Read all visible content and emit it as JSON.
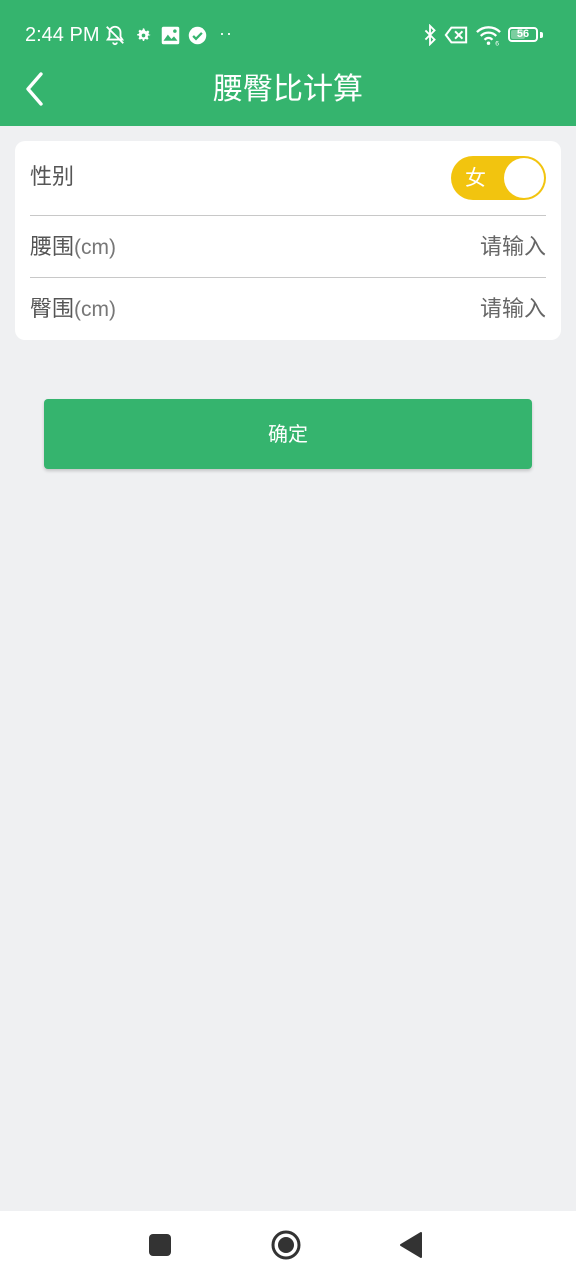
{
  "status_bar": {
    "time": "2:44 PM",
    "extra_indicator": "··",
    "battery_level": "56",
    "icons": [
      "muted-alarm-icon",
      "settings-gear-icon",
      "image-icon",
      "check-circle-icon",
      "bluetooth-icon",
      "no-sim-icon",
      "wifi-icon",
      "battery-icon"
    ]
  },
  "header": {
    "title": "腰臀比计算",
    "back_icon": "chevron-left-icon"
  },
  "form": {
    "gender_label": "性别",
    "gender_value": "女",
    "waist_label": "腰围",
    "waist_unit": "(cm)",
    "waist_placeholder": "请输入",
    "waist_value": "",
    "hip_label": "臀围",
    "hip_unit": "(cm)",
    "hip_placeholder": "请输入",
    "hip_value": ""
  },
  "confirm_button": {
    "label": "确定"
  },
  "nav_bar": {
    "icons": [
      "recents-square-icon",
      "home-circle-icon",
      "back-triangle-icon"
    ]
  },
  "colors": {
    "primary": "#35b46e",
    "toggle": "#f2c40f",
    "background": "#eff0f2"
  }
}
